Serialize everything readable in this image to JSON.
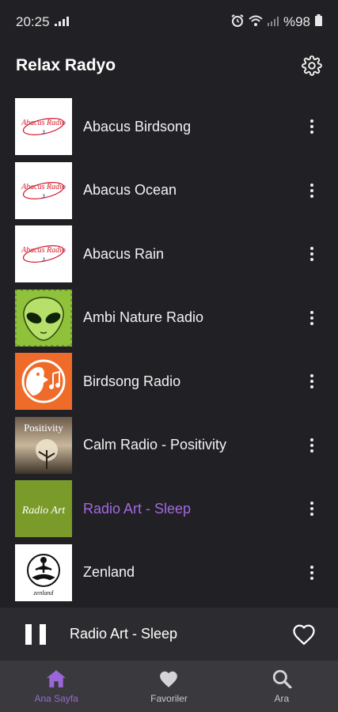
{
  "status_bar": {
    "time": "20:25",
    "battery": "%98",
    "icons": [
      "signal-icon",
      "alarm-icon",
      "wifi-icon",
      "signal-icon",
      "battery-icon"
    ]
  },
  "header": {
    "title": "Relax Radyo",
    "settings_icon": "gear-icon"
  },
  "stations": [
    {
      "name": "Abacus Birdsong",
      "logo": "abacus",
      "active": false
    },
    {
      "name": "Abacus Ocean",
      "logo": "abacus",
      "active": false
    },
    {
      "name": "Abacus Rain",
      "logo": "abacus",
      "active": false
    },
    {
      "name": "Ambi Nature Radio",
      "logo": "alien",
      "active": false
    },
    {
      "name": "Birdsong Radio",
      "logo": "birdsong",
      "active": false
    },
    {
      "name": "Calm Radio - Positivity",
      "logo": "positivity",
      "active": false
    },
    {
      "name": "Radio Art - Sleep",
      "logo": "radioart",
      "active": true
    },
    {
      "name": "Zenland",
      "logo": "zenland",
      "active": false
    }
  ],
  "logo_texts": {
    "abacus": "Abacus Radio",
    "positivity": "Positivity",
    "radioart": "Radio Art",
    "zenland": "zenland"
  },
  "player": {
    "now_playing": "Radio Art - Sleep",
    "state": "playing"
  },
  "nav": {
    "items": [
      {
        "label": "Ana Sayfa",
        "icon": "home-icon",
        "active": true
      },
      {
        "label": "Favoriler",
        "icon": "heart-icon",
        "active": false
      },
      {
        "label": "Ara",
        "icon": "search-icon",
        "active": false
      }
    ]
  },
  "colors": {
    "background": "#212125",
    "accent": "#a368e0",
    "player_bar": "#2c2c30",
    "nav_bar": "#3a3a3e"
  }
}
